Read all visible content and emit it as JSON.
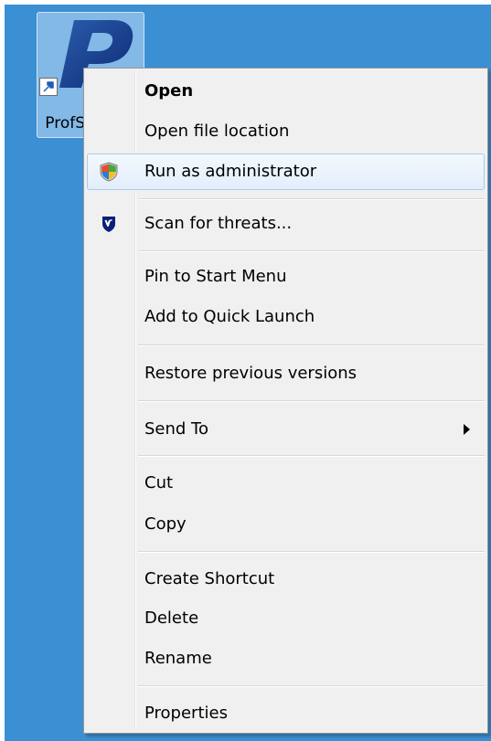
{
  "desktop": {
    "icon_label": "ProfS"
  },
  "menu": {
    "items": [
      {
        "label": "Open",
        "bold": true
      },
      {
        "label": "Open file location"
      },
      {
        "label": "Run as administrator",
        "icon": "uac-shield-icon",
        "highlighted": true
      },
      {
        "label": "Scan for threats...",
        "icon": "antivirus-shield-icon"
      },
      {
        "label": "Pin to Start Menu"
      },
      {
        "label": "Add to Quick Launch"
      },
      {
        "label": "Restore previous versions"
      },
      {
        "label": "Send To",
        "submenu": true
      },
      {
        "label": "Cut"
      },
      {
        "label": "Copy"
      },
      {
        "label": "Create Shortcut"
      },
      {
        "label": "Delete"
      },
      {
        "label": "Rename"
      },
      {
        "label": "Properties"
      }
    ]
  },
  "colors": {
    "desktop_background": "#3b8fd3",
    "menu_background": "#f0f0f0",
    "highlight_border": "#a8cbee"
  }
}
